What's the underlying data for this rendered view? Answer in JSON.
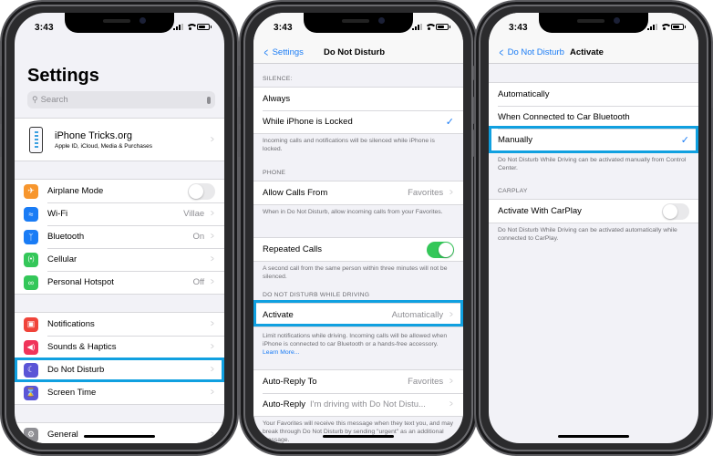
{
  "status_bar": {
    "time": "3:43"
  },
  "phone1": {
    "title": "Settings",
    "search": {
      "placeholder": "Search"
    },
    "profile": {
      "name": "iPhone Tricks.org",
      "subtitle": "Apple ID, iCloud, Media & Purchases"
    },
    "group1": [
      {
        "label": "Airplane Mode",
        "icon": "airplane-icon",
        "color": "#f7962d",
        "control": "toggle",
        "on": false
      },
      {
        "label": "Wi-Fi",
        "icon": "wifi-icon",
        "color": "#1a7cf5",
        "value": "Villae"
      },
      {
        "label": "Bluetooth",
        "icon": "bluetooth-icon",
        "color": "#1a7cf5",
        "value": "On"
      },
      {
        "label": "Cellular",
        "icon": "cellular-icon",
        "color": "#34c759",
        "value": ""
      },
      {
        "label": "Personal Hotspot",
        "icon": "hotspot-icon",
        "color": "#34c759",
        "value": "Off"
      }
    ],
    "group2": [
      {
        "label": "Notifications",
        "icon": "notifications-icon",
        "color": "#f0443a"
      },
      {
        "label": "Sounds & Haptics",
        "icon": "sounds-icon",
        "color": "#f0345a"
      },
      {
        "label": "Do Not Disturb",
        "icon": "moon-icon",
        "color": "#5a55d6",
        "highlighted": true
      },
      {
        "label": "Screen Time",
        "icon": "hourglass-icon",
        "color": "#5a55d6"
      }
    ],
    "group3": [
      {
        "label": "General",
        "icon": "gear-icon",
        "color": "#8e8e93"
      }
    ]
  },
  "phone2": {
    "back_label": "Settings",
    "title": "Do Not Disturb",
    "silence_header": "SILENCE:",
    "silence_options": [
      {
        "label": "Always",
        "checked": false
      },
      {
        "label": "While iPhone is Locked",
        "checked": true
      }
    ],
    "silence_footer": "Incoming calls and notifications will be silenced while iPhone is locked.",
    "phone_header": "PHONE",
    "allow_calls": {
      "label": "Allow Calls From",
      "value": "Favorites"
    },
    "allow_calls_footer": "When in Do Not Disturb, allow incoming calls from your Favorites.",
    "repeated_calls": {
      "label": "Repeated Calls",
      "on": true
    },
    "repeated_calls_footer": "A second call from the same person within three minutes will not be silenced.",
    "driving_header": "DO NOT DISTURB WHILE DRIVING",
    "activate": {
      "label": "Activate",
      "value": "Automatically"
    },
    "activate_footer": "Limit notifications while driving. Incoming calls will be allowed when iPhone is connected to car Bluetooth or a hands-free accessory.",
    "learn_more": "Learn More...",
    "auto_reply_to": {
      "label": "Auto-Reply To",
      "value": "Favorites"
    },
    "auto_reply": {
      "label": "Auto-Reply",
      "value": "I'm driving with Do Not Distu..."
    },
    "auto_reply_footer": "Your Favorites will receive this message when they text you, and may break through Do Not Disturb by sending \"urgent\" as an additional message."
  },
  "phone3": {
    "back_label": "Do Not Disturb",
    "title": "Activate",
    "options": [
      {
        "label": "Automatically",
        "checked": false
      },
      {
        "label": "When Connected to Car Bluetooth",
        "checked": false
      },
      {
        "label": "Manually",
        "checked": true
      }
    ],
    "options_footer": "Do Not Disturb While Driving can be activated manually from Control Center.",
    "carplay_header": "CARPLAY",
    "carplay": {
      "label": "Activate With CarPlay",
      "on": false
    },
    "carplay_footer": "Do Not Disturb While Driving can be activated automatically while connected to CarPlay."
  },
  "highlight_color": "#10a0e0"
}
